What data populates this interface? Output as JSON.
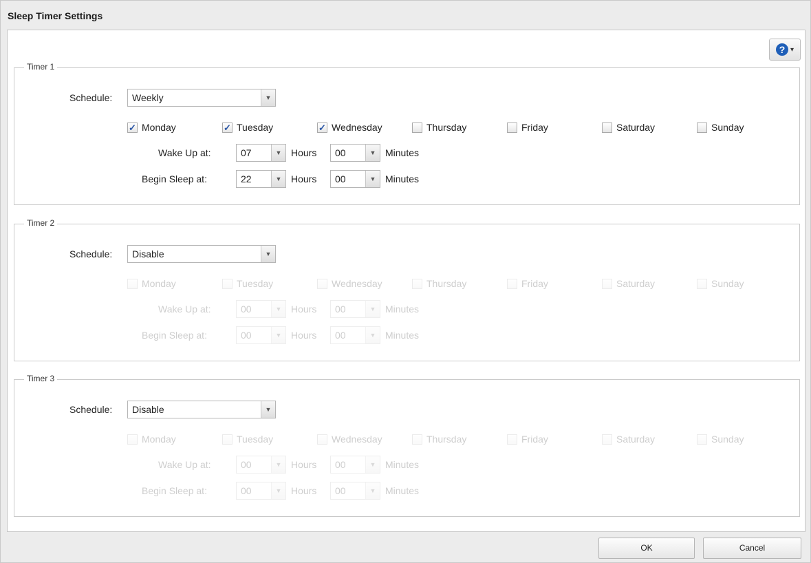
{
  "dialog": {
    "title": "Sleep Timer Settings"
  },
  "help": {
    "icon": "help-icon",
    "glyph": "?",
    "caret": "▾"
  },
  "labels": {
    "schedule": "Schedule:",
    "wake_up": "Wake Up at:",
    "begin_sleep": "Begin Sleep at:",
    "hours": "Hours",
    "minutes": "Minutes"
  },
  "days": [
    "Monday",
    "Tuesday",
    "Wednesday",
    "Thursday",
    "Friday",
    "Saturday",
    "Sunday"
  ],
  "check_glyph": "✓",
  "arrow_glyph": "▼",
  "timers": [
    {
      "legend": "Timer 1",
      "schedule": "Weekly",
      "enabled": true,
      "checked": [
        true,
        true,
        true,
        false,
        false,
        false,
        false
      ],
      "wake_hour": "07",
      "wake_minute": "00",
      "sleep_hour": "22",
      "sleep_minute": "00"
    },
    {
      "legend": "Timer 2",
      "schedule": "Disable",
      "enabled": false,
      "checked": [
        false,
        false,
        false,
        false,
        false,
        false,
        false
      ],
      "wake_hour": "00",
      "wake_minute": "00",
      "sleep_hour": "00",
      "sleep_minute": "00"
    },
    {
      "legend": "Timer 3",
      "schedule": "Disable",
      "enabled": false,
      "checked": [
        false,
        false,
        false,
        false,
        false,
        false,
        false
      ],
      "wake_hour": "00",
      "wake_minute": "00",
      "sleep_hour": "00",
      "sleep_minute": "00"
    }
  ],
  "buttons": {
    "ok": "OK",
    "cancel": "Cancel"
  }
}
